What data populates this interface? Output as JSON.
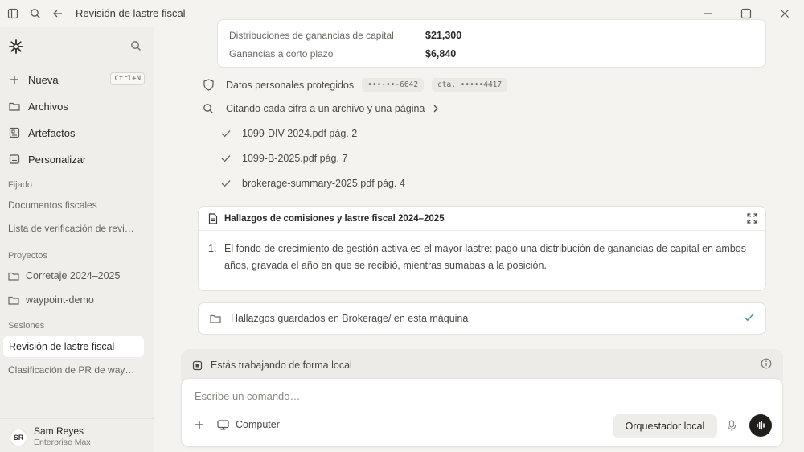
{
  "titlebar": {
    "title": "Revisión de lastre fiscal"
  },
  "sidebar": {
    "nav": [
      {
        "label": "Nueva",
        "shortcut": "Ctrl+N",
        "icon": "plus-icon"
      },
      {
        "label": "Archivos",
        "icon": "folder-icon"
      },
      {
        "label": "Artefactos",
        "icon": "artifact-icon"
      },
      {
        "label": "Personalizar",
        "icon": "customize-icon"
      }
    ],
    "pinned_heading": "Fijado",
    "pinned": [
      "Documentos fiscales",
      "Lista de verificación de revi…"
    ],
    "projects_heading": "Proyectos",
    "projects": [
      "Corretaje 2024–2025",
      "waypoint-demo"
    ],
    "sessions_heading": "Sesiones",
    "sessions_active": "Revisión de lastre fiscal",
    "sessions": [
      "Clasificación de PR de way…"
    ],
    "user": {
      "initials": "SR",
      "name": "Sam Reyes",
      "plan": "Enterprise Max"
    }
  },
  "gains": [
    {
      "label": "Distribuciones de ganancias de capital",
      "value": "$21,300"
    },
    {
      "label": "Ganancias a corto plazo",
      "value": "$6,840"
    }
  ],
  "privacy": {
    "label": "Datos personales protegidos",
    "chips": [
      "•••-••-6642",
      "cta. •••••4417"
    ]
  },
  "citing": {
    "label": "Citando cada cifra a un archivo y una página",
    "sources": [
      "1099-DIV-2024.pdf pág. 2",
      "1099-B-2025.pdf pág. 7",
      "brokerage-summary-2025.pdf pág. 4"
    ]
  },
  "findings": {
    "title": "Hallazgos de comisiones y lastre fiscal 2024–2025",
    "items": [
      {
        "num": "1.",
        "text": "El fondo de crecimiento de gestión activa es el mayor lastre: pagó una distribución de ganancias de capital en ambos años, gravada el año en que se recibió, mientras sumabas a la posición."
      }
    ]
  },
  "saved": {
    "label": "Hallazgos guardados en Brokerage/ en esta máquina"
  },
  "local": {
    "label": "Estás trabajando de forma local"
  },
  "composer": {
    "placeholder": "Escribe un comando…",
    "computer_label": "Computer",
    "orchestrator_label": "Orquestador local"
  }
}
